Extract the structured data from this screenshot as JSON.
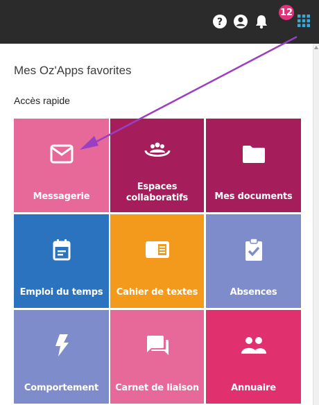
{
  "topbar": {
    "notification_count": "12",
    "icons": [
      "help-icon",
      "user-icon",
      "bell-icon",
      "apps-grid-icon"
    ],
    "background": "#2b2b2b",
    "badge_color": "#e0337b",
    "apps_icon_color": "#3aa8d8"
  },
  "panel": {
    "title": "Mes Oz'Apps favorites",
    "section": "Accès rapide"
  },
  "tiles": [
    {
      "label": "Messagerie",
      "icon": "envelope-icon",
      "color": "#e6699a"
    },
    {
      "label": "Espaces collaboratifs",
      "icon": "group-icon",
      "color": "#a51d5b"
    },
    {
      "label": "Mes documents",
      "icon": "folder-icon",
      "color": "#a51d5b"
    },
    {
      "label": "Emploi du temps",
      "icon": "calendar-icon",
      "color": "#2b72bf"
    },
    {
      "label": "Cahier de textes",
      "icon": "notebook-icon",
      "color": "#f39a1c"
    },
    {
      "label": "Absences",
      "icon": "clipboard-check-icon",
      "color": "#7e8ccb"
    },
    {
      "label": "Comportement",
      "icon": "lightning-icon",
      "color": "#7e8ccb"
    },
    {
      "label": "Carnet de liaison",
      "icon": "chat-icon",
      "color": "#e6699a"
    },
    {
      "label": "Annuaire",
      "icon": "people-icon",
      "color": "#e0306d"
    }
  ],
  "annotation": {
    "arrow_color": "#9b3fc2"
  }
}
